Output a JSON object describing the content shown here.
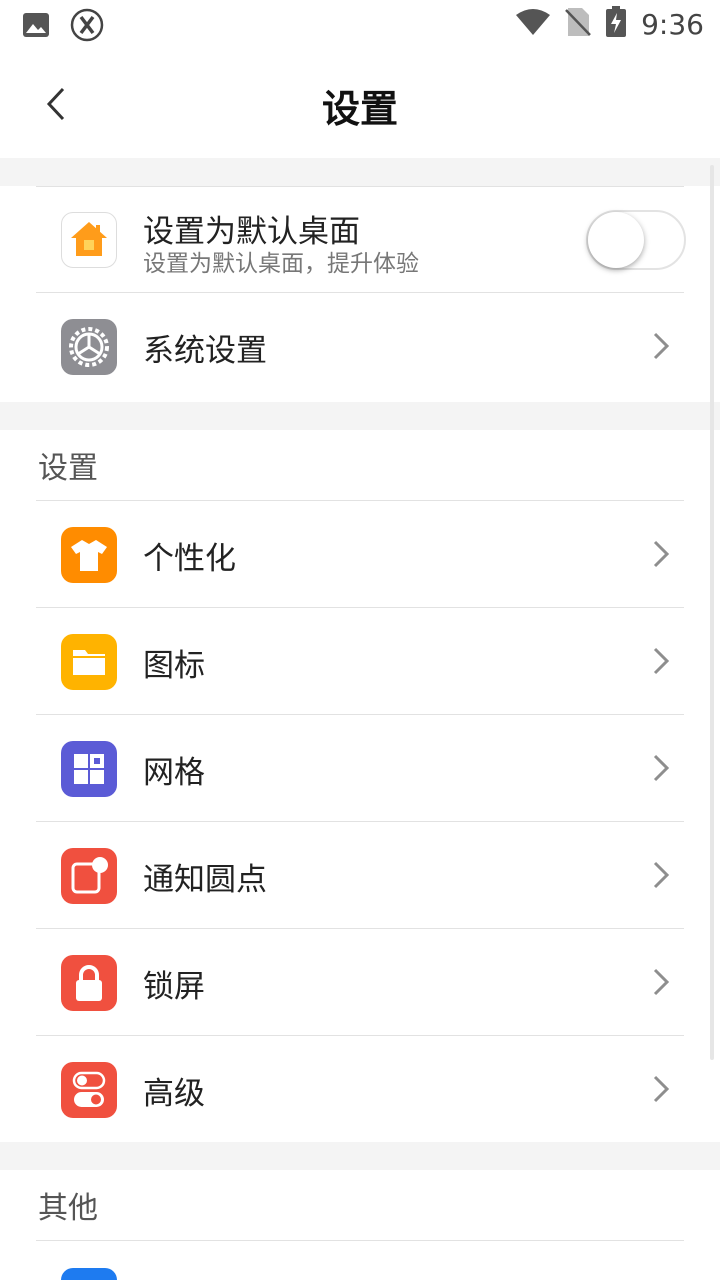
{
  "status_bar": {
    "time": "9:36"
  },
  "header": {
    "title": "设置"
  },
  "default_launcher": {
    "title": "设置为默认桌面",
    "subtitle": "设置为默认桌面，提升体验",
    "enabled": false
  },
  "system_settings": {
    "label": "系统设置"
  },
  "settings_section": {
    "header": "设置",
    "items": [
      {
        "label": "个性化",
        "icon": "tshirt-icon",
        "color": "#ff8c00"
      },
      {
        "label": "图标",
        "icon": "folder-icon",
        "color": "#ffb300"
      },
      {
        "label": "网格",
        "icon": "grid-icon",
        "color": "#5b5bd6"
      },
      {
        "label": "通知圆点",
        "icon": "notification-dot-icon",
        "color": "#f0503f"
      },
      {
        "label": "锁屏",
        "icon": "lock-icon",
        "color": "#f0503f"
      },
      {
        "label": "高级",
        "icon": "toggles-icon",
        "color": "#f0503f"
      }
    ]
  },
  "other_section": {
    "header": "其他"
  },
  "colors": {
    "background": "#f4f4f4",
    "divider": "#e2e2e2",
    "chevron": "#8e8e8e"
  }
}
